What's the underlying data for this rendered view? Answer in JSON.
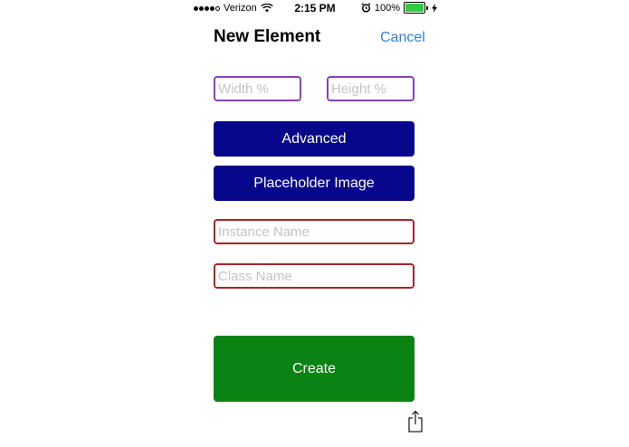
{
  "status_bar": {
    "carrier": "Verizon",
    "time": "2:15 PM",
    "battery_text": "100%",
    "battery_level": 1.0,
    "signal_bars": 4,
    "signal_total": 5,
    "icons": [
      "wifi-icon",
      "alarm-icon",
      "charging-bolt-icon"
    ],
    "battery_color": "#2ecc40"
  },
  "nav": {
    "title": "New Element",
    "cancel_label": "Cancel",
    "cancel_color": "#2f7fe0"
  },
  "form": {
    "width_placeholder": "Width %",
    "height_placeholder": "Height %",
    "advanced_label": "Advanced",
    "placeholder_image_label": "Placeholder Image",
    "instance_placeholder": "Instance Name",
    "class_placeholder": "Class Name",
    "create_label": "Create"
  },
  "colors": {
    "navy_button": "#06078a",
    "create_button": "#0a8214",
    "purple_border": "#8a3fc0",
    "red_border": "#a8242a"
  },
  "toolbar": {
    "share_icon": "share-icon"
  }
}
